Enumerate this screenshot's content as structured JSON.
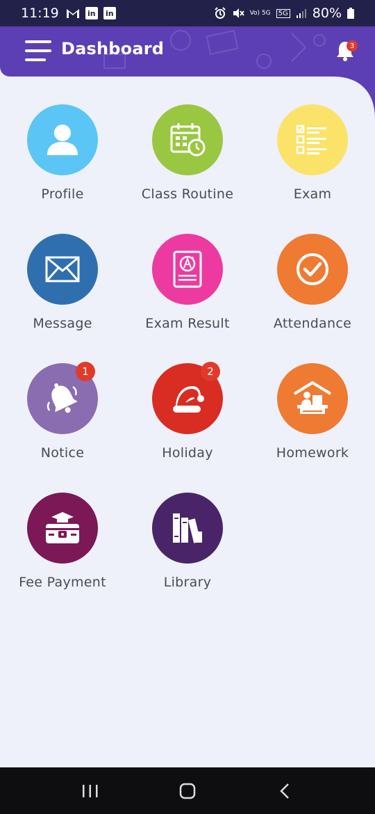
{
  "status": {
    "time": "11:19",
    "left_icons": [
      "gmail-icon",
      "linkedin-icon",
      "linkedin-icon"
    ],
    "battery": "80%",
    "network_label": "5G",
    "volte_label": "Vo) 5G"
  },
  "header": {
    "title": "Dashboard",
    "notification_count": "3",
    "color": "#5c3fb5"
  },
  "tiles": [
    {
      "label": "Profile",
      "color": "#5bc6f5",
      "icon": "user-icon"
    },
    {
      "label": "Class Routine",
      "color": "#9ac741",
      "icon": "calendar-clock-icon"
    },
    {
      "label": "Exam",
      "color": "#fbe36a",
      "icon": "checklist-icon"
    },
    {
      "label": "Message",
      "color": "#2f6fb0",
      "icon": "envelope-icon"
    },
    {
      "label": "Exam Result",
      "color": "#ec3aa1",
      "icon": "grade-sheet-icon"
    },
    {
      "label": "Attendance",
      "color": "#ef7a32",
      "icon": "check-circle-icon"
    },
    {
      "label": "Notice",
      "color": "#8a6cb1",
      "icon": "bell-icon",
      "badge": "1"
    },
    {
      "label": "Holiday",
      "color": "#d92c22",
      "icon": "santa-hat-icon",
      "badge": "2"
    },
    {
      "label": "Homework",
      "color": "#ef7a32",
      "icon": "study-desk-icon"
    },
    {
      "label": "Fee Payment",
      "color": "#7b1855",
      "icon": "money-box-icon"
    },
    {
      "label": "Library",
      "color": "#4a2468",
      "icon": "books-icon"
    }
  ]
}
